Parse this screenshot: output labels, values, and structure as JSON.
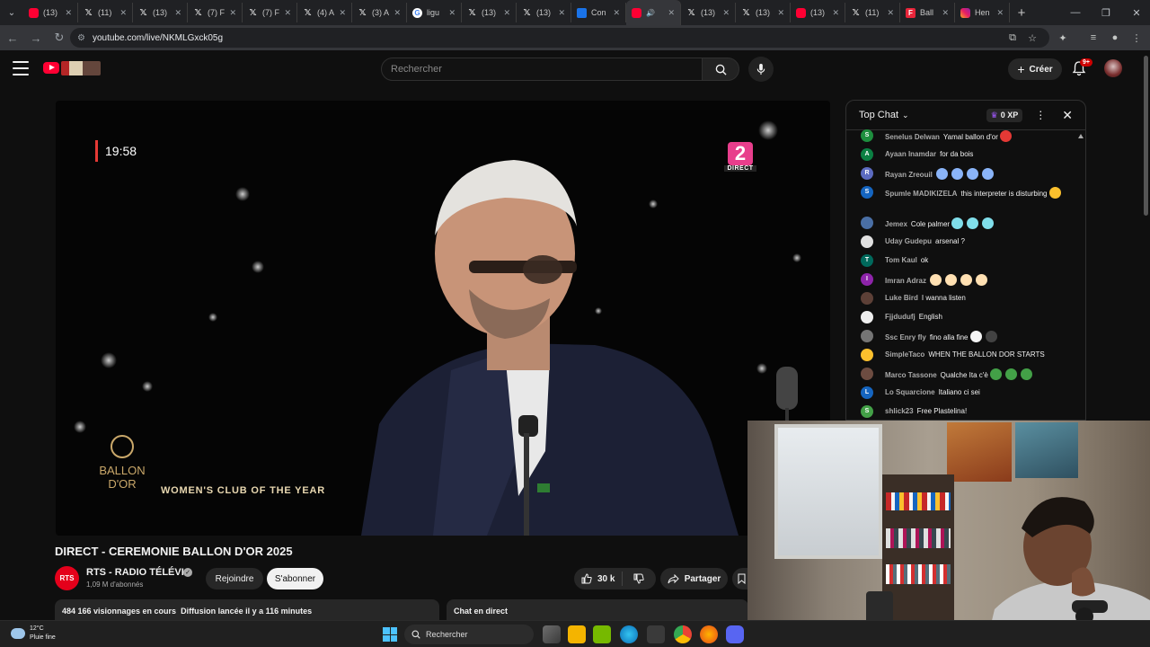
{
  "browser": {
    "tabs": [
      {
        "label": "(13)",
        "fav": "yt",
        "fav_text": ""
      },
      {
        "label": "(11)",
        "fav": "x",
        "fav_text": "𝕏"
      },
      {
        "label": "(13)",
        "fav": "x",
        "fav_text": "𝕏"
      },
      {
        "label": "(7) F",
        "fav": "x",
        "fav_text": "𝕏"
      },
      {
        "label": "(7) F",
        "fav": "x",
        "fav_text": "𝕏"
      },
      {
        "label": "(4) A",
        "fav": "x",
        "fav_text": "𝕏"
      },
      {
        "label": "(3) A",
        "fav": "x",
        "fav_text": "𝕏"
      },
      {
        "label": "ligu",
        "fav": "g",
        "fav_text": "G"
      },
      {
        "label": "(13)",
        "fav": "x",
        "fav_text": "𝕏"
      },
      {
        "label": "(13)",
        "fav": "x",
        "fav_text": "𝕏"
      },
      {
        "label": "Con",
        "fav": "b",
        "fav_text": ""
      },
      {
        "label": "",
        "fav": "yt",
        "fav_text": "",
        "active": true,
        "audio": "🔊"
      },
      {
        "label": "(13)",
        "fav": "x",
        "fav_text": "𝕏"
      },
      {
        "label": "(13)",
        "fav": "x",
        "fav_text": "𝕏"
      },
      {
        "label": "(13)",
        "fav": "yt",
        "fav_text": ""
      },
      {
        "label": "(11)",
        "fav": "x",
        "fav_text": "𝕏"
      },
      {
        "label": "Ball",
        "fav": "f",
        "fav_text": "F"
      },
      {
        "label": "Hen",
        "fav": "ig",
        "fav_text": ""
      }
    ],
    "url": "youtube.com/live/NKMLGxck05g"
  },
  "youtube": {
    "search_placeholder": "Rechercher",
    "create_label": "Créer",
    "notif_badge": "9+"
  },
  "video": {
    "timer": "19:58",
    "channel_number": "2",
    "channel_tag": "DIRECT",
    "award_logo_line1": "BALLON",
    "award_logo_line2": "D'OR",
    "caption": "WOMEN'S CLUB OF THE YEAR"
  },
  "info": {
    "title": "DIRECT - CEREMONIE BALLON D'OR 2025",
    "channel_avatar": "RTS",
    "channel_name": "RTS - RADIO TÉLÉVI...",
    "subscribers": "1,09 M d'abonnés",
    "join_label": "Rejoindre",
    "subscribe_label": "S'abonner",
    "likes": "30 k",
    "share_label": "Partager",
    "views": "484 166 visionnages en cours",
    "started": "Diffusion lancée il y a 116 minutes",
    "chat_replay_label": "Chat en direct"
  },
  "chat": {
    "mode": "Top Chat",
    "xp": "0 XP",
    "messages": [
      {
        "author": "Senelus Delwan",
        "text": "Yamal ballon d'or",
        "av": "S",
        "avc": "#1e8e3e",
        "emoji": [
          "#e53935"
        ]
      },
      {
        "author": "Ayaan Inamdar",
        "text": "for da bois",
        "av": "A",
        "avc": "#0b8043",
        "emoji": []
      },
      {
        "author": "Rayan Zreouil",
        "text": "",
        "av": "R",
        "avc": "#5c6bc0",
        "emoji": [
          "#8ab4f8",
          "#8ab4f8",
          "#8ab4f8",
          "#8ab4f8"
        ]
      },
      {
        "author": "Spumle MADIKIZELA",
        "text": "this interpreter is disturbing",
        "av": "S",
        "avc": "#1565c0",
        "emoji": [
          "#fbc02d"
        ],
        "tall": true
      },
      {
        "author": "Jemex",
        "text": "Cole palmer",
        "av": "",
        "avc": "#4a6fa5",
        "emoji": [
          "#80deea",
          "#80deea",
          "#80deea"
        ]
      },
      {
        "author": "Uday Gudepu",
        "text": "arsenal ?",
        "av": "",
        "avc": "#e0e0e0",
        "emoji": []
      },
      {
        "author": "Tom Kaul",
        "text": "ok",
        "av": "T",
        "avc": "#00695c",
        "emoji": []
      },
      {
        "author": "Imran Adraz",
        "text": "",
        "av": "I",
        "avc": "#8e24aa",
        "emoji": [
          "#ffe0b2",
          "#ffe0b2",
          "#ffe0b2",
          "#ffe0b2"
        ]
      },
      {
        "author": "Luke Bird",
        "text": "I wanna listen",
        "av": "",
        "avc": "#5d4037",
        "emoji": []
      },
      {
        "author": "Fjjdudufj",
        "text": "English",
        "av": "",
        "avc": "#eeeeee",
        "emoji": []
      },
      {
        "author": "Ssc Enry fly",
        "text": "fino alla fine",
        "av": "",
        "avc": "#757575",
        "emoji": [
          "#f5f5f5",
          "#424242"
        ]
      },
      {
        "author": "SimpleTaco",
        "text": "WHEN THE BALLON DOR STARTS",
        "av": "",
        "avc": "#fbc02d",
        "emoji": []
      },
      {
        "author": "Marco Tassone",
        "text": "Qualche Ita c'è",
        "av": "",
        "avc": "#6d4c41",
        "emoji": [
          "#43a047",
          "#43a047",
          "#43a047"
        ]
      },
      {
        "author": "Lo Squarcione",
        "text": "Italiano ci sei",
        "av": "L",
        "avc": "#1565c0",
        "emoji": []
      },
      {
        "author": "shlick23",
        "text": "Free Plastelina!",
        "av": "S",
        "avc": "#43a047",
        "emoji": []
      }
    ]
  },
  "taskbar": {
    "temp": "12°C",
    "weather": "Pluie fine",
    "search": "Rechercher"
  }
}
